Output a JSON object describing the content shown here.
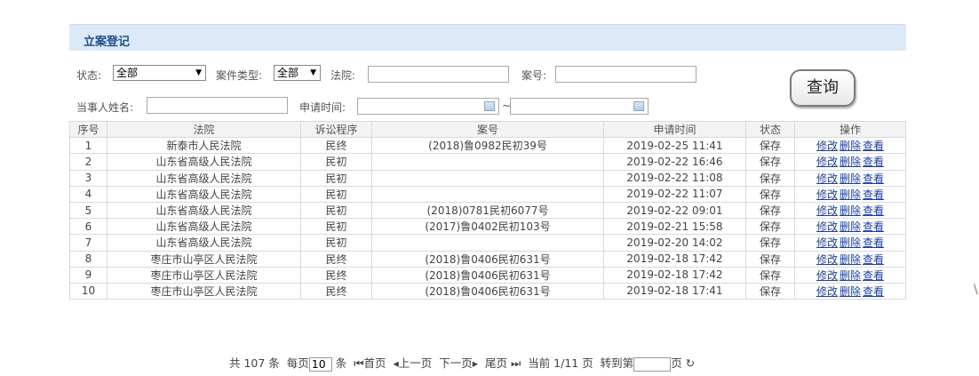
{
  "panel": {
    "title": "立案登记"
  },
  "filters": {
    "status_label": "状态:",
    "status_value": "全部",
    "case_type_label": "案件类型:",
    "case_type_value": "全部",
    "court_label": "法院:",
    "court_value": "",
    "case_no_label": "案号:",
    "case_no_value": "",
    "party_label": "当事人姓名:",
    "party_value": "",
    "apply_time_label": "申请时间:",
    "tilde": "~",
    "query_button": "查询"
  },
  "table": {
    "headers": [
      "序号",
      "法院",
      "诉讼程序",
      "案号",
      "申请时间",
      "状态",
      "操作"
    ],
    "rows": [
      [
        "1",
        "新泰市人民法院",
        "民终",
        "(2018)鲁0982民初39号",
        "2019-02-25 11:41",
        "保存"
      ],
      [
        "2",
        "山东省高级人民法院",
        "民初",
        "",
        "2019-02-22 16:46",
        "保存"
      ],
      [
        "3",
        "山东省高级人民法院",
        "民初",
        "",
        "2019-02-22 11:08",
        "保存"
      ],
      [
        "4",
        "山东省高级人民法院",
        "民初",
        "",
        "2019-02-22 11:07",
        "保存"
      ],
      [
        "5",
        "山东省高级人民法院",
        "民初",
        "(2018)0781民初6077号",
        "2019-02-22 09:01",
        "保存"
      ],
      [
        "6",
        "山东省高级人民法院",
        "民初",
        "(2017)鲁0402民初103号",
        "2019-02-21 15:58",
        "保存"
      ],
      [
        "7",
        "山东省高级人民法院",
        "民初",
        "",
        "2019-02-20 14:02",
        "保存"
      ],
      [
        "8",
        "枣庄市山亭区人民法院",
        "民终",
        "(2018)鲁0406民初631号",
        "2019-02-18 17:42",
        "保存"
      ],
      [
        "9",
        "枣庄市山亭区人民法院",
        "民终",
        "(2018)鲁0406民初631号",
        "2019-02-18 17:42",
        "保存"
      ],
      [
        "10",
        "枣庄市山亭区人民法院",
        "民终",
        "(2018)鲁0406民初631号",
        "2019-02-18 17:41",
        "保存"
      ]
    ],
    "ops": [
      "修改",
      "删除",
      "查看"
    ]
  },
  "pager": {
    "total": "共 107 条",
    "per_page_prefix": "每页",
    "per_page_value": "10",
    "per_page_suffix": "条",
    "first": "首页",
    "prev": "上一页",
    "next": "下一页",
    "last": "尾页",
    "current": "当前 1/11 页",
    "goto_prefix": "转到第",
    "goto_suffix": "页"
  }
}
